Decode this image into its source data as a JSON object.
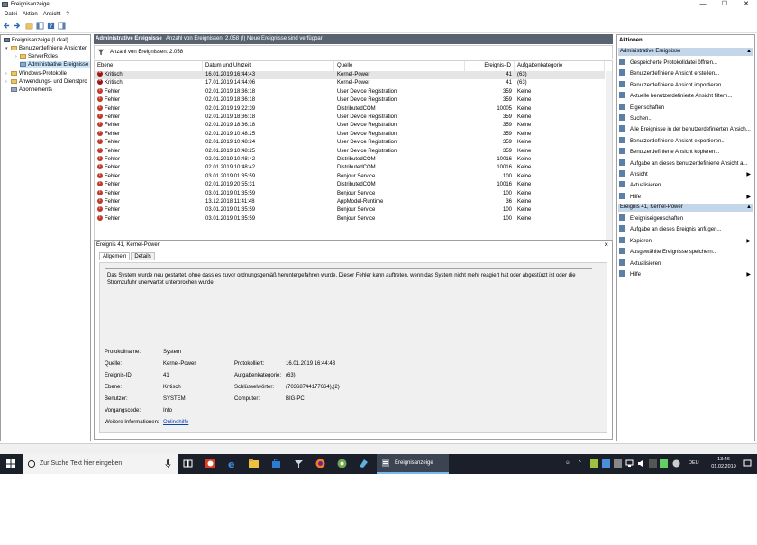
{
  "window": {
    "title": "Ereignisanzeige",
    "buttons": {
      "minimize": "—",
      "maximize": "☐",
      "close": "✕"
    }
  },
  "menu": [
    "Datei",
    "Aktion",
    "Ansicht",
    "?"
  ],
  "tree": {
    "root": "Ereignisanzeige (Lokal)",
    "custom_views": "Benutzerdefinierte Ansichten",
    "server_roles": "ServerRoles",
    "admin_events": "Administrative Ereignisse",
    "windows_logs": "Windows-Protokolle",
    "app_service_logs": "Anwendungs- und Dienstpro",
    "subscriptions": "Abonnements"
  },
  "center": {
    "header_title": "Administrative Ereignisse",
    "header_info": "Anzahl von Ereignissen: 2.058 (!) Neue Ereignisse sind verfügbar",
    "filter_text": "Anzahl von Ereignissen: 2.058",
    "columns": [
      "Ebene",
      "Datum und Uhrzeit",
      "Quelle",
      "Ereignis-ID",
      "Aufgabenkategorie"
    ],
    "rows": [
      {
        "level": "Kritisch",
        "date": "16.01.2019 16:44:43",
        "source": "Kernel-Power",
        "id": "41",
        "cat": "(63)",
        "type": "crit"
      },
      {
        "level": "Kritisch",
        "date": "17.01.2019 14:44:06",
        "source": "Kernel-Power",
        "id": "41",
        "cat": "(63)",
        "type": "crit"
      },
      {
        "level": "Fehler",
        "date": "02.01.2019 18:36:18",
        "source": "User Device Registration",
        "id": "359",
        "cat": "Keine",
        "type": "err"
      },
      {
        "level": "Fehler",
        "date": "02.01.2019 18:36:18",
        "source": "User Device Registration",
        "id": "359",
        "cat": "Keine",
        "type": "err"
      },
      {
        "level": "Fehler",
        "date": "02.01.2019 19:22:39",
        "source": "DistributedCOM",
        "id": "10005",
        "cat": "Keine",
        "type": "err"
      },
      {
        "level": "Fehler",
        "date": "02.01.2019 18:36:18",
        "source": "User Device Registration",
        "id": "359",
        "cat": "Keine",
        "type": "err"
      },
      {
        "level": "Fehler",
        "date": "02.01.2019 18:36:18",
        "source": "User Device Registration",
        "id": "359",
        "cat": "Keine",
        "type": "err"
      },
      {
        "level": "Fehler",
        "date": "02.01.2019 10:48:25",
        "source": "User Device Registration",
        "id": "359",
        "cat": "Keine",
        "type": "err"
      },
      {
        "level": "Fehler",
        "date": "02.01.2019 10:48:24",
        "source": "User Device Registration",
        "id": "359",
        "cat": "Keine",
        "type": "err"
      },
      {
        "level": "Fehler",
        "date": "02.01.2019 10:48:25",
        "source": "User Device Registration",
        "id": "359",
        "cat": "Keine",
        "type": "err"
      },
      {
        "level": "Fehler",
        "date": "02.01.2019 10:48:42",
        "source": "DistributedCOM",
        "id": "10016",
        "cat": "Keine",
        "type": "err"
      },
      {
        "level": "Fehler",
        "date": "02.01.2019 10:48:42",
        "source": "DistributedCOM",
        "id": "10016",
        "cat": "Keine",
        "type": "err"
      },
      {
        "level": "Fehler",
        "date": "03.01.2019 01:35:59",
        "source": "Bonjour Service",
        "id": "100",
        "cat": "Keine",
        "type": "err"
      },
      {
        "level": "Fehler",
        "date": "02.01.2019 20:55:31",
        "source": "DistributedCOM",
        "id": "10016",
        "cat": "Keine",
        "type": "err"
      },
      {
        "level": "Fehler",
        "date": "03.01.2019 01:35:59",
        "source": "Bonjour Service",
        "id": "100",
        "cat": "Keine",
        "type": "err"
      },
      {
        "level": "Fehler",
        "date": "13.12.2018 11:41:48",
        "source": "AppModel-Runtime",
        "id": "36",
        "cat": "Keine",
        "type": "err"
      },
      {
        "level": "Fehler",
        "date": "03.01.2019 01:35:59",
        "source": "Bonjour Service",
        "id": "100",
        "cat": "Keine",
        "type": "err"
      },
      {
        "level": "Fehler",
        "date": "03.01.2019 01:35:59",
        "source": "Bonjour Service",
        "id": "100",
        "cat": "Keine",
        "type": "err"
      }
    ]
  },
  "detail": {
    "title": "Ereignis 41, Kernel-Power",
    "close": "×",
    "tabs": [
      "Allgemein",
      "Details"
    ],
    "description": "Das System wurde neu gestartet, ohne dass es zuvor ordnungsgemäß heruntergefahren wurde. Dieser Fehler kann auftreten, wenn das System nicht mehr reagiert hat oder abgestürzt ist oder die Stromzufuhr unerwartet unterbrochen wurde.",
    "labels": {
      "log_name": "Protokollname:",
      "source": "Quelle:",
      "event_id": "Ereignis-ID:",
      "level": "Ebene:",
      "user": "Benutzer:",
      "opcode": "Vorgangscode:",
      "more_info": "Weitere Informationen:",
      "logged": "Protokolliert:",
      "task_category": "Aufgabenkategorie:",
      "keywords": "Schlüsselwörter:",
      "computer": "Computer:"
    },
    "values": {
      "log_name": "System",
      "source": "Kernel-Power",
      "event_id": "41",
      "level": "Kritisch",
      "user": "SYSTEM",
      "opcode": "Info",
      "more_info": "Onlinehilfe",
      "logged": "16.01.2019 16:44:43",
      "task_category": "(63)",
      "keywords": "(70368744177664),(2)",
      "computer": "BIG-PC"
    }
  },
  "actions": {
    "title": "Aktionen",
    "section1": "Administrative Ereignisse",
    "items1": [
      {
        "label": "Gespeicherte Protokolldatei öffnen...",
        "arrow": ""
      },
      {
        "label": "Benutzerdefinierte Ansicht erstellen...",
        "arrow": ""
      },
      {
        "label": "Benutzerdefinierte Ansicht importieren...",
        "arrow": ""
      },
      {
        "label": "Aktuelle benutzerdefinierte Ansicht filtern...",
        "arrow": ""
      },
      {
        "label": "Eigenschaften",
        "arrow": ""
      },
      {
        "label": "Suchen...",
        "arrow": ""
      },
      {
        "label": "Alle Ereignisse in der benutzerdefinierten Ansich...",
        "arrow": ""
      },
      {
        "label": "Benutzerdefinierte Ansicht exportieren...",
        "arrow": ""
      },
      {
        "label": "Benutzerdefinierte Ansicht kopieren...",
        "arrow": ""
      },
      {
        "label": "Aufgabe an dieses benutzerdefinierte Ansicht a...",
        "arrow": ""
      },
      {
        "label": "Ansicht",
        "arrow": "▶"
      },
      {
        "label": "Aktualisieren",
        "arrow": ""
      },
      {
        "label": "Hilfe",
        "arrow": "▶"
      }
    ],
    "section2": "Ereignis 41, Kernel-Power",
    "items2": [
      {
        "label": "Ereigniseigenschaften",
        "arrow": ""
      },
      {
        "label": "Aufgabe an dieses Ereignis anfügen...",
        "arrow": ""
      },
      {
        "label": "Kopieren",
        "arrow": "▶"
      },
      {
        "label": "Ausgewählte Ereignisse speichern...",
        "arrow": ""
      },
      {
        "label": "Aktualisieren",
        "arrow": ""
      },
      {
        "label": "Hilfe",
        "arrow": "▶"
      }
    ]
  },
  "taskbar": {
    "search_placeholder": "Zur Suche Text hier eingeben",
    "active_app": "Ereignisanzeige",
    "lang": "DEU",
    "time": "13:46",
    "date": "01.02.2019"
  }
}
